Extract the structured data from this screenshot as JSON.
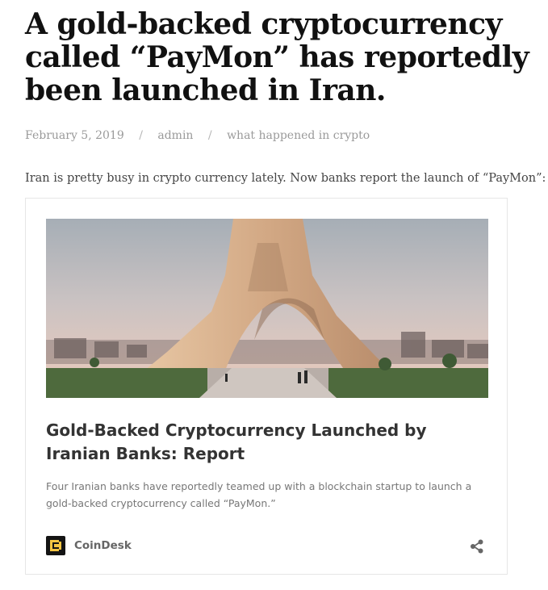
{
  "post": {
    "title": "A gold-backed cryptocurrency called “PayMon” has reportedly been launched in Iran.",
    "date": "February 5, 2019",
    "separator": "/",
    "author": "admin",
    "category": "what happened in crypto",
    "intro": "Iran is pretty busy in crypto currency lately. Now banks report the launch of “PayMon”:"
  },
  "embed": {
    "title": "Gold-Backed Cryptocurrency Launched by Iranian Banks: Report",
    "description": "Four Iranian banks have reportedly teamed up with a blockchain startup to launch a gold-backed cryptocurrency called “PayMon.”",
    "source": "CoinDesk",
    "source_logo_icon": "coindesk-logo-icon",
    "share_icon": "share-icon",
    "image_icon": "azadi-tower-photo",
    "colors": {
      "logo_bg": "#141414",
      "logo_accent": "#f5c542"
    }
  }
}
